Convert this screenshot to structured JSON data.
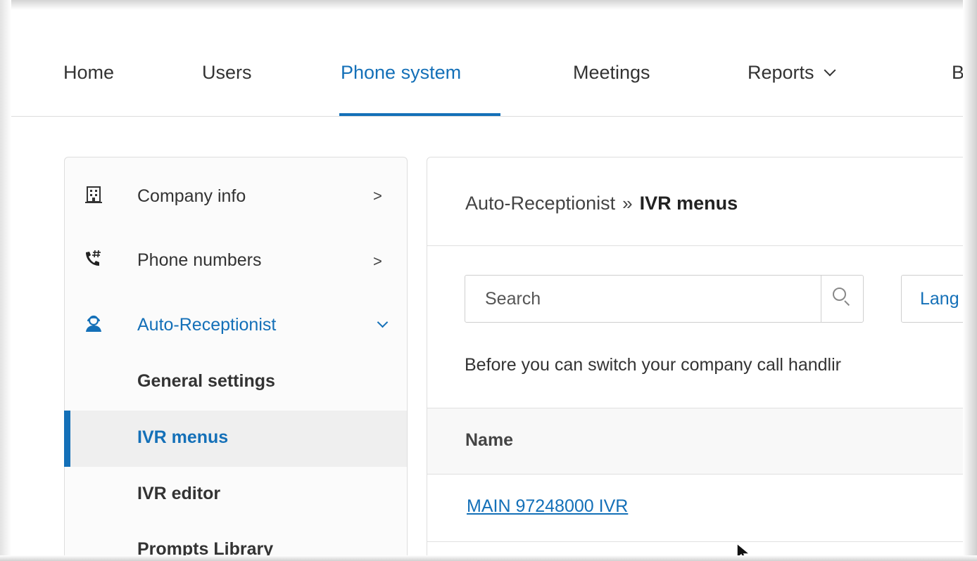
{
  "nav": {
    "items": [
      {
        "label": "Home"
      },
      {
        "label": "Users"
      },
      {
        "label": "Phone system"
      },
      {
        "label": "Meetings"
      },
      {
        "label": "Reports"
      },
      {
        "label": "B"
      }
    ],
    "active": "Phone system"
  },
  "sidebar": {
    "items": [
      {
        "label": "Company info",
        "icon": "building-icon",
        "caret": ">"
      },
      {
        "label": "Phone numbers",
        "icon": "phone-hash-icon",
        "caret": ">"
      },
      {
        "label": "Auto-Receptionist",
        "icon": "receptionist-icon",
        "expanded": true
      }
    ],
    "subitems": [
      {
        "label": "General settings"
      },
      {
        "label": "IVR menus",
        "active": true
      },
      {
        "label": "IVR editor"
      },
      {
        "label": "Prompts Library"
      }
    ]
  },
  "main": {
    "breadcrumb": {
      "parent": "Auto-Receptionist",
      "separator": "»",
      "current": "IVR menus"
    },
    "search": {
      "placeholder": "Search"
    },
    "language_button": "Lang",
    "info_text": "Before you can switch your company call handlir",
    "table": {
      "header": "Name",
      "rows": [
        {
          "name": "MAIN 97248000 IVR"
        }
      ]
    }
  },
  "colors": {
    "accent": "#1470b8",
    "text": "#333333",
    "border": "#dedede"
  }
}
